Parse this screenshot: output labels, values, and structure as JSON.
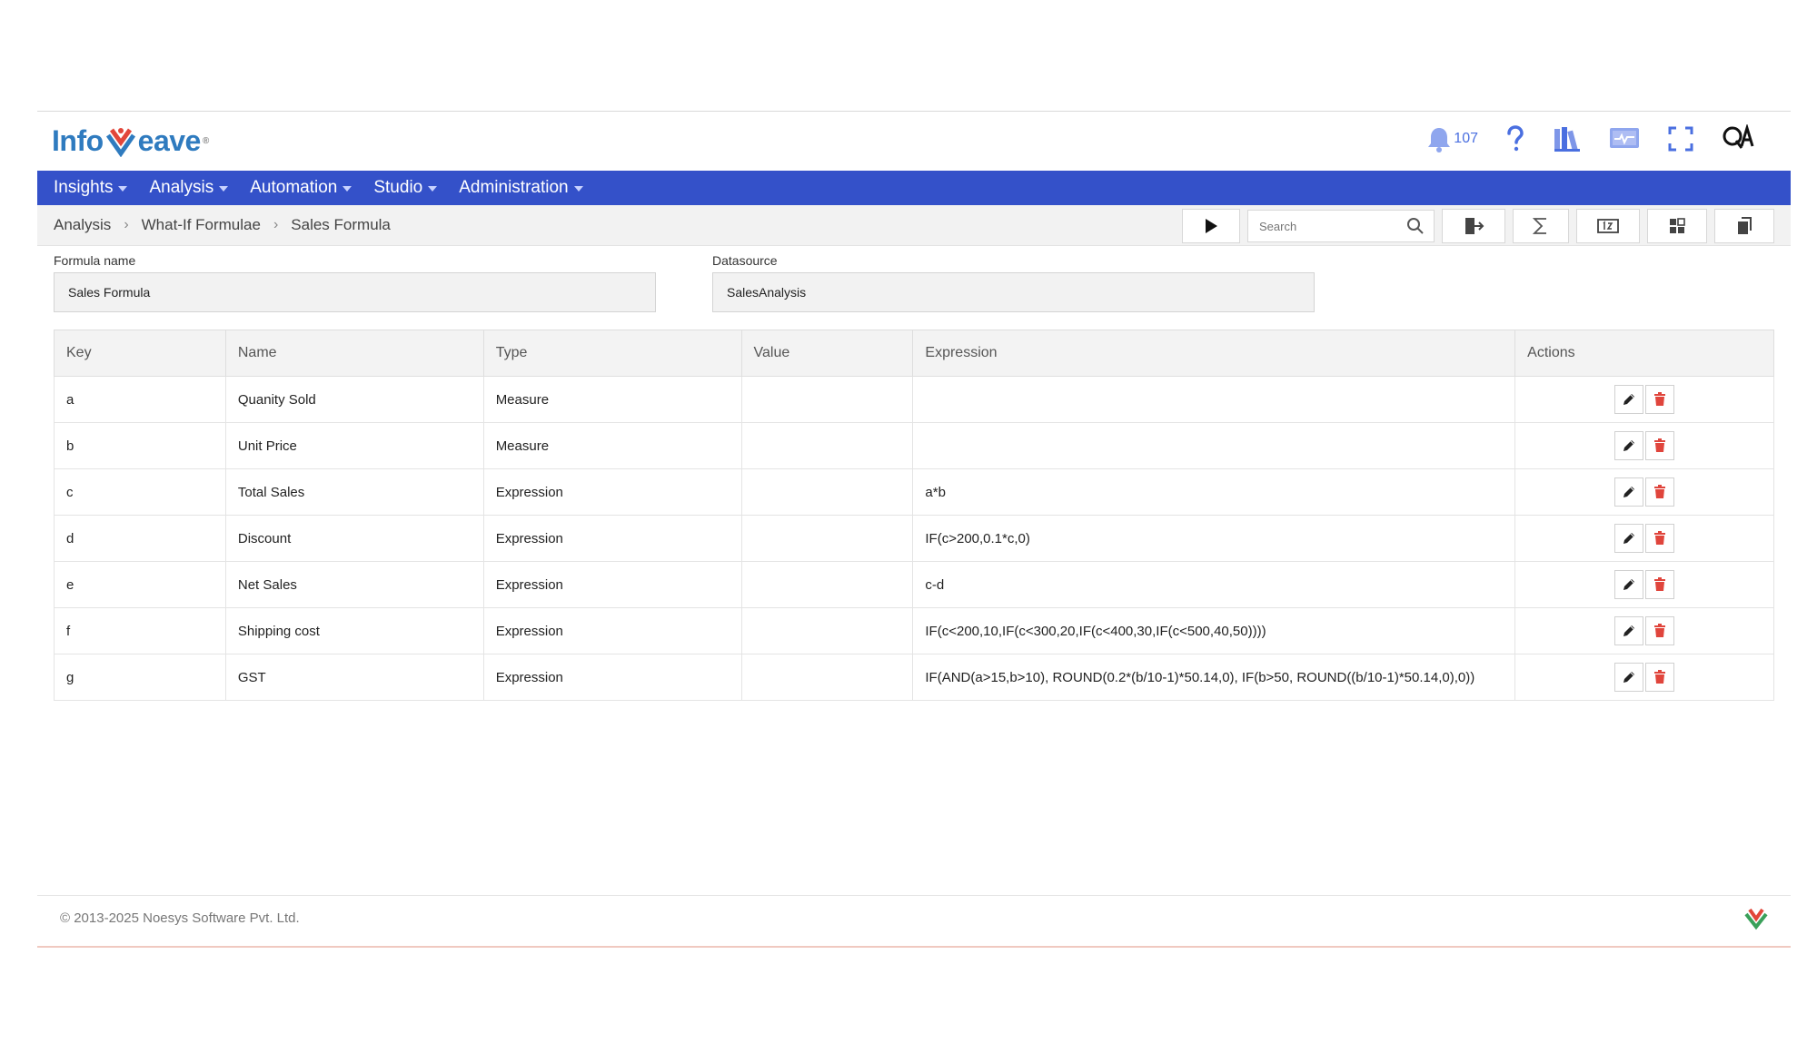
{
  "brand": {
    "logo_left": "Info",
    "logo_right": "eave"
  },
  "header": {
    "notification_count": "107",
    "icons": [
      "bell-icon",
      "help-icon",
      "library-icon",
      "monitor-icon",
      "fullscreen-icon",
      "qa-icon"
    ]
  },
  "nav": {
    "items": [
      {
        "label": "Insights"
      },
      {
        "label": "Analysis"
      },
      {
        "label": "Automation"
      },
      {
        "label": "Studio"
      },
      {
        "label": "Administration"
      }
    ]
  },
  "breadcrumb": {
    "items": [
      "Analysis",
      "What-If Formulae",
      "Sales Formula"
    ]
  },
  "toolbar": {
    "search_placeholder": "Search"
  },
  "form": {
    "formula_name_label": "Formula name",
    "formula_name_value": "Sales Formula",
    "datasource_label": "Datasource",
    "datasource_value": "SalesAnalysis"
  },
  "table": {
    "headers": [
      "Key",
      "Name",
      "Type",
      "Value",
      "Expression",
      "Actions"
    ],
    "rows": [
      {
        "key": "a",
        "name": "Quanity Sold",
        "type": "Measure",
        "value": "",
        "expression": ""
      },
      {
        "key": "b",
        "name": "Unit Price",
        "type": "Measure",
        "value": "",
        "expression": ""
      },
      {
        "key": "c",
        "name": "Total Sales",
        "type": "Expression",
        "value": "",
        "expression": "a*b"
      },
      {
        "key": "d",
        "name": "Discount",
        "type": "Expression",
        "value": "",
        "expression": "IF(c>200,0.1*c,0)"
      },
      {
        "key": "e",
        "name": "Net Sales",
        "type": "Expression",
        "value": "",
        "expression": "c-d"
      },
      {
        "key": "f",
        "name": "Shipping cost",
        "type": "Expression",
        "value": "",
        "expression": "IF(c<200,10,IF(c<300,20,IF(c<400,30,IF(c<500,40,50))))"
      },
      {
        "key": "g",
        "name": "GST",
        "type": "Expression",
        "value": "",
        "expression": "IF(AND(a>15,b>10), ROUND(0.2*(b/10-1)*50.14,0), IF(b>50, ROUND((b/10-1)*50.14,0),0))"
      }
    ]
  },
  "footer": {
    "copyright": "© 2013-2025 Noesys Software Pvt. Ltd."
  },
  "colors": {
    "nav_bg": "#3451c9",
    "accent": "#4a6fe0",
    "delete": "#e0453c"
  }
}
